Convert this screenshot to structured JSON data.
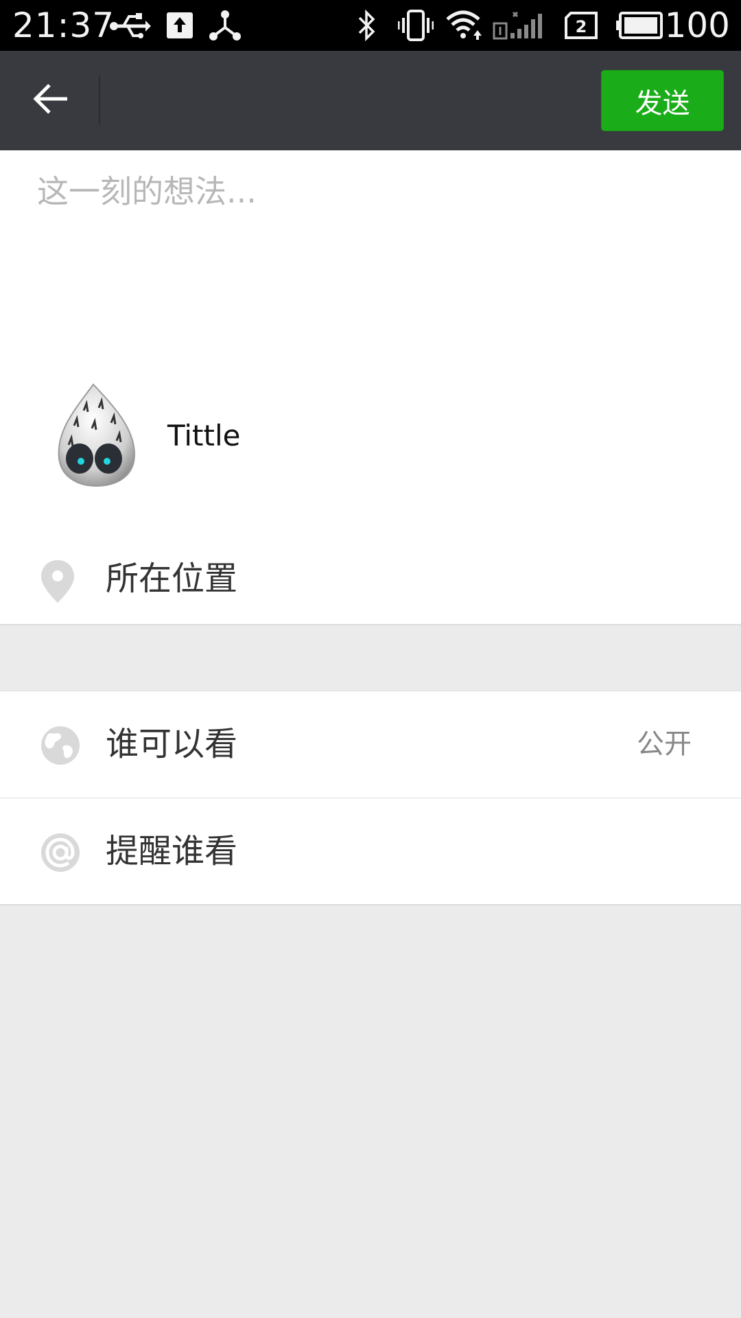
{
  "status_bar": {
    "time": "21:37",
    "battery_level": "100",
    "icons": [
      "usb-icon",
      "upload-icon",
      "share-icon",
      "bluetooth-icon",
      "vibrate-icon",
      "wifi-icon",
      "signal-icon",
      "sim-icon",
      "battery-icon"
    ]
  },
  "header": {
    "back_icon": "arrow-left-icon",
    "send_label": "发送",
    "accent_color": "#1aad19",
    "background_color": "#393a3f"
  },
  "composer": {
    "placeholder": "这一刻的想法...",
    "value": ""
  },
  "link_card": {
    "title": "Tittle",
    "thumb_icon": "mascot-icon"
  },
  "location": {
    "label": "所在位置",
    "icon": "location-pin-icon"
  },
  "settings": {
    "items": [
      {
        "label": "谁可以看",
        "value": "公开",
        "icon": "globe-icon"
      },
      {
        "label": "提醒谁看",
        "value": "",
        "icon": "at-icon"
      }
    ]
  }
}
